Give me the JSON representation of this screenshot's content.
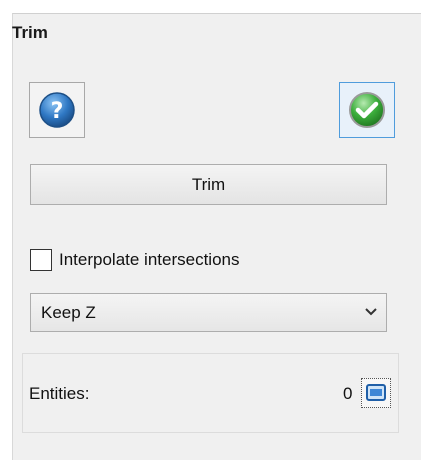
{
  "panel": {
    "title": "Trim"
  },
  "toolbar": {
    "help_icon": "help-question-icon",
    "ok_icon": "checkmark-ok-icon"
  },
  "trim_button": {
    "label": "Trim"
  },
  "interpolate": {
    "label": "Interpolate intersections",
    "checked": false
  },
  "z_mode": {
    "selected": "Keep Z"
  },
  "entities": {
    "label": "Entities:",
    "count": "0"
  },
  "colors": {
    "help_blue": "#2f78c4",
    "ok_green": "#3cae3c",
    "focus_border": "#4f9cdc"
  }
}
